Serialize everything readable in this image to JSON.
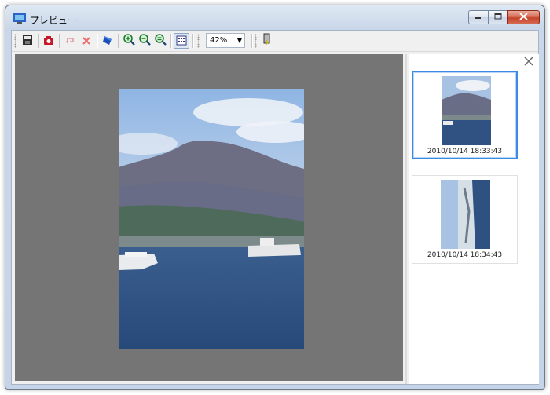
{
  "window": {
    "title": "プレビュー",
    "buttons": {
      "minimize_icon": "minimize-icon",
      "maximize_icon": "maximize-icon",
      "close_icon": "close-icon"
    }
  },
  "toolbar": {
    "buttons": [
      {
        "name": "save-button",
        "icon": "save-icon"
      },
      {
        "name": "camera-button",
        "icon": "camera-icon"
      },
      {
        "name": "undo-button",
        "icon": "undo-icon"
      },
      {
        "name": "delete-button",
        "icon": "delete-icon"
      },
      {
        "name": "rotate-button",
        "icon": "rotate-icon"
      },
      {
        "name": "zoom-in-button",
        "icon": "zoom-in-icon"
      },
      {
        "name": "zoom-out-button",
        "icon": "zoom-out-icon"
      },
      {
        "name": "zoom-fit-button",
        "icon": "zoom-fit-icon"
      },
      {
        "name": "thumbnail-view-button",
        "icon": "thumbnail-view-icon"
      },
      {
        "name": "exit-button",
        "icon": "exit-icon"
      }
    ],
    "zoom": {
      "value": "42%"
    }
  },
  "thumbnails": {
    "close_icon": "close-icon",
    "items": [
      {
        "label": "2010/10/14 18:33:43",
        "selected": true
      },
      {
        "label": "2010/10/14 18:34:43",
        "selected": false
      }
    ]
  },
  "colors": {
    "preview_background": "#757575",
    "selection": "#3c8ae3"
  }
}
